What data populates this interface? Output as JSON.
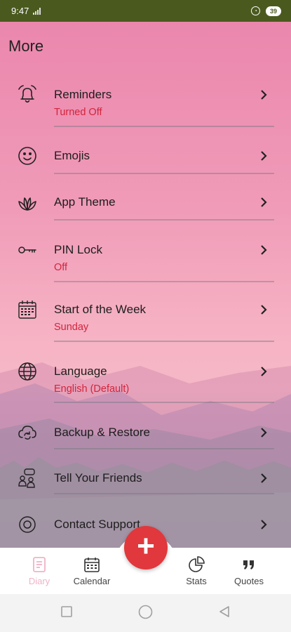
{
  "status_bar": {
    "time": "9:47",
    "battery": "39"
  },
  "page": {
    "title": "More"
  },
  "colors": {
    "status_bar": "#4a5a1f",
    "subtitle_red": "#d3243c",
    "fab_red": "#e0383c",
    "active_tab": "#f0b3c6"
  },
  "menu": [
    {
      "label": "Reminders",
      "subtitle": "Turned Off",
      "icon": "bell-icon"
    },
    {
      "label": "Emojis",
      "subtitle": "",
      "icon": "smiley-icon"
    },
    {
      "label": "App Theme",
      "subtitle": "",
      "icon": "lotus-icon"
    },
    {
      "label": "PIN Lock",
      "subtitle": "Off",
      "icon": "key-icon"
    },
    {
      "label": "Start of the Week",
      "subtitle": "Sunday",
      "icon": "calendar-icon"
    },
    {
      "label": "Language",
      "subtitle": "English (Default)",
      "icon": "globe-icon"
    },
    {
      "label": "Backup & Restore",
      "subtitle": "",
      "icon": "cloud-sync-icon"
    },
    {
      "label": "Tell Your Friends",
      "subtitle": "",
      "icon": "people-chat-icon"
    },
    {
      "label": "Contact Support",
      "subtitle": "",
      "icon": "support-icon"
    }
  ],
  "bottom_nav": {
    "diary": "Diary",
    "calendar": "Calendar",
    "stats": "Stats",
    "quotes": "Quotes",
    "active": "diary"
  },
  "fab": {
    "label": "+"
  }
}
